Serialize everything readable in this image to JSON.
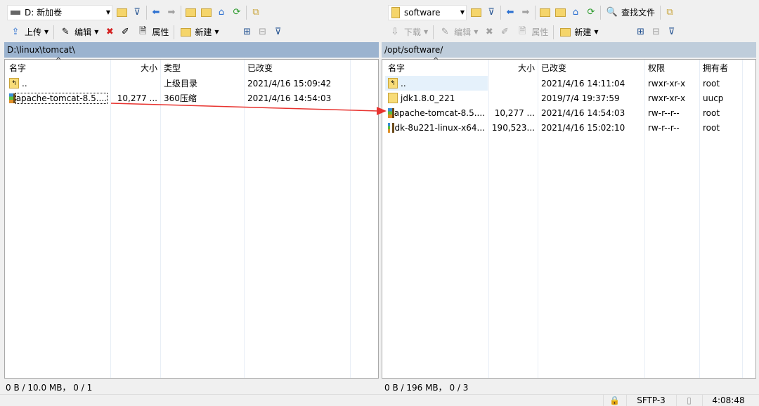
{
  "left": {
    "drive": "D: 新加卷",
    "toolbar": {
      "upload": "上传",
      "edit": "编辑",
      "properties": "属性",
      "new": "新建"
    },
    "path": "D:\\linux\\tomcat\\",
    "columns": [
      "名字",
      "大小",
      "类型",
      "已改变"
    ],
    "rows": [
      {
        "name": "..",
        "size": "",
        "type": "上级目录",
        "changed": "2021/4/16  15:09:42",
        "icon": "parent-folder"
      },
      {
        "name": "apache-tomcat-8.5....",
        "size": "10,277 ...",
        "type": "360压缩",
        "changed": "2021/4/16  14:54:03",
        "icon": "archive"
      }
    ],
    "status": "0 B / 10.0 MB，  0 / 1"
  },
  "right": {
    "drive": "software",
    "find": "查找文件",
    "toolbar": {
      "download": "下载",
      "edit": "编辑",
      "properties": "属性",
      "new": "新建"
    },
    "path": "/opt/software/",
    "columns": [
      "名字",
      "大小",
      "已改变",
      "权限",
      "拥有者"
    ],
    "rows": [
      {
        "name": "..",
        "size": "",
        "changed": "2021/4/16 14:11:04",
        "perm": "rwxr-xr-x",
        "owner": "root",
        "icon": "parent-folder"
      },
      {
        "name": "jdk1.8.0_221",
        "size": "",
        "changed": "2019/7/4 19:37:59",
        "perm": "rwxr-xr-x",
        "owner": "uucp",
        "icon": "folder"
      },
      {
        "name": "apache-tomcat-8.5....",
        "size": "10,277 ...",
        "changed": "2021/4/16 14:54:03",
        "perm": "rw-r--r--",
        "owner": "root",
        "icon": "archive"
      },
      {
        "name": "jdk-8u221-linux-x64...",
        "size": "190,523...",
        "changed": "2021/4/16 15:02:10",
        "perm": "rw-r--r--",
        "owner": "root",
        "icon": "archive"
      }
    ],
    "status": "0 B / 196 MB，  0 / 3"
  },
  "statusbar": {
    "protocol": "SFTP-3",
    "time": "4:08:48"
  },
  "colors": {
    "path_active": "#9bb3cf",
    "path_inactive": "#bfcddb",
    "arrow": "#e8332f"
  }
}
